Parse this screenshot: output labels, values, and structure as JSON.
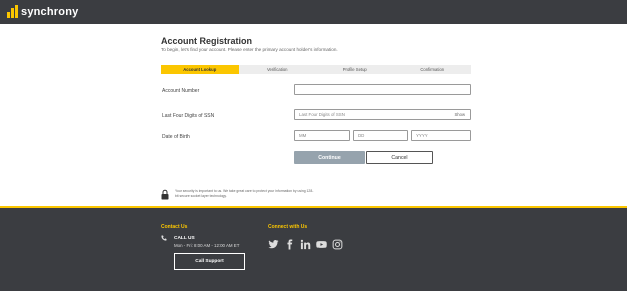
{
  "brand": {
    "name": "synchrony"
  },
  "page": {
    "title": "Account Registration",
    "subtitle": "To begin, let's find your account. Please enter the primary account holder's information."
  },
  "steps": [
    {
      "label": "Account Lookup",
      "active": true
    },
    {
      "label": "Verification",
      "active": false
    },
    {
      "label": "Profile Setup",
      "active": false
    },
    {
      "label": "Confirmation",
      "active": false
    }
  ],
  "form": {
    "account_number": {
      "label": "Account Number",
      "value": "",
      "placeholder": ""
    },
    "ssn": {
      "label": "Last Four Digits of SSN",
      "placeholder": "Last Four Digits of SSN",
      "show_label": "Show"
    },
    "dob": {
      "label": "Date of Birth",
      "mm": "MM",
      "dd": "DD",
      "yyyy": "YYYY"
    },
    "continue_label": "Continue",
    "cancel_label": "Cancel"
  },
  "security_note": "Your security is important to us. We take great care to protect your information by using 128-bit secure socket layer technology.",
  "footer": {
    "contact_heading": "Contact Us",
    "call_us": "CALL US",
    "hours": "Mon - Fri: 8:00 AM - 12:00 AM ET",
    "call_support": "Call Support",
    "connect_heading": "Connect with Us",
    "socials": [
      "twitter-icon",
      "facebook-icon",
      "linkedin-icon",
      "youtube-icon",
      "instagram-icon"
    ]
  },
  "colors": {
    "accent": "#fbc600",
    "header_bg": "#3b3d41",
    "continue_bg": "#96a3ad"
  }
}
